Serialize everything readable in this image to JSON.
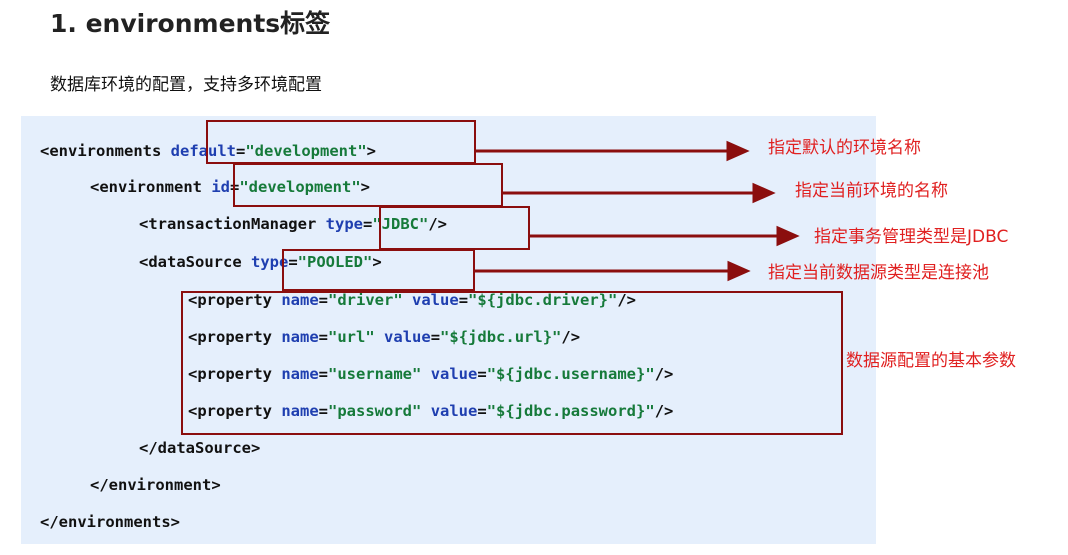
{
  "heading": "1. environments标签",
  "intro": "数据库环境的配置，支持多环境配置",
  "code": {
    "l1": {
      "tag": "<environments",
      "attr": "default",
      "eq": "=",
      "val": "\"development\"",
      "end": ">"
    },
    "l2": {
      "tag": "<environment",
      "attr": "id",
      "eq": "=",
      "val": "\"development\"",
      "end": ">"
    },
    "l3": {
      "tag": "<transactionManager",
      "attr": "type",
      "eq": "=",
      "val": "\"JDBC\"",
      "end": "/>"
    },
    "l4": {
      "tag": "<dataSource",
      "attr": "type",
      "eq": "=",
      "val": "\"POOLED\"",
      "end": ">"
    },
    "properties": [
      {
        "tag": "<property",
        "name_attr": "name",
        "eq1": "=",
        "name_val": "\"driver\"",
        "value_attr": "value",
        "eq2": "=",
        "value_val": "\"${jdbc.driver}\"",
        "end": "/>"
      },
      {
        "tag": "<property",
        "name_attr": "name",
        "eq1": "=",
        "name_val": "\"url\"",
        "value_attr": "value",
        "eq2": "=",
        "value_val": "\"${jdbc.url}\"",
        "end": "/>"
      },
      {
        "tag": "<property",
        "name_attr": "name",
        "eq1": "=",
        "name_val": "\"username\"",
        "value_attr": "value",
        "eq2": "=",
        "value_val": "\"${jdbc.username}\"",
        "end": "/>"
      },
      {
        "tag": "<property",
        "name_attr": "name",
        "eq1": "=",
        "name_val": "\"password\"",
        "value_attr": "value",
        "eq2": "=",
        "value_val": "\"${jdbc.password}\"",
        "end": "/>"
      }
    ],
    "close_datasource": "</dataSource>",
    "close_environment": "</environment>",
    "close_environments": "</environments>"
  },
  "annotations": {
    "default_env": "指定默认的环境名称",
    "current_env": "指定当前环境的名称",
    "transaction": "指定事务管理类型是JDBC",
    "datasource": "指定当前数据源类型是连接池",
    "params": "数据源配置的基本参数"
  },
  "colors": {
    "box_border": "#8b0e0e",
    "annotation_text": "#e02020",
    "code_bg": "#e5effc",
    "attr": "#1f3fb0",
    "value": "#167a3a"
  }
}
